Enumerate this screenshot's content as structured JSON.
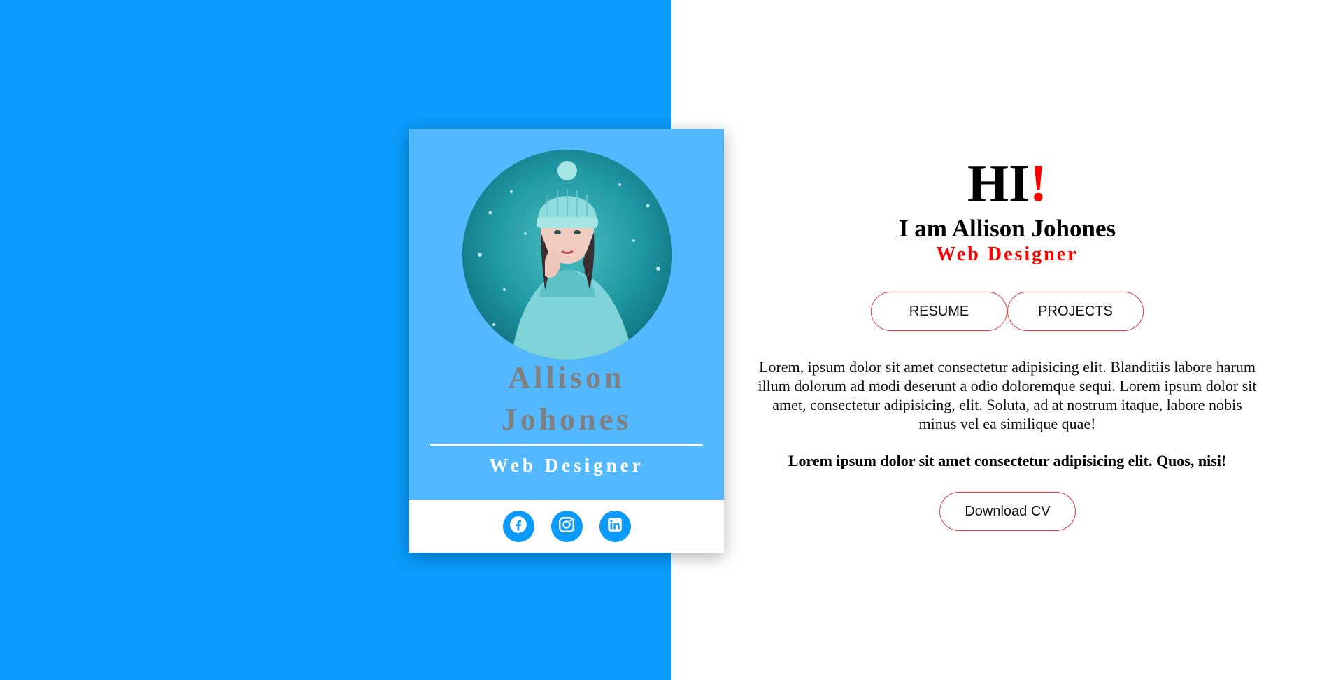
{
  "colors": {
    "left_background": "#0a9bfc",
    "card_top": "#53b8fd",
    "accent_red": "#ff0000",
    "button_border": "#e8383d",
    "name_gray": "#808080"
  },
  "card": {
    "name_line1": "Allison",
    "name_line2": "Johones",
    "role": "Web Designer",
    "social": [
      {
        "icon": "facebook-icon",
        "label": "Facebook"
      },
      {
        "icon": "instagram-icon",
        "label": "Instagram"
      },
      {
        "icon": "linkedin-icon",
        "label": "LinkedIn"
      }
    ]
  },
  "hero": {
    "greeting": "HI",
    "greeting_mark": "!",
    "intro": "I am Allison Johones",
    "role": "Web Designer"
  },
  "buttons": {
    "resume": "RESUME",
    "projects": "PROJECTS",
    "download": "Download CV"
  },
  "content": {
    "description": "Lorem, ipsum dolor sit amet consectetur adipisicing elit. Blanditiis labore harum illum dolorum ad modi deserunt a odio doloremque sequi. Lorem ipsum dolor sit amet, consectetur adipisicing, elit. Soluta, ad at nostrum itaque, labore nobis minus vel ea similique quae!",
    "highlight": "Lorem ipsum dolor sit amet consectetur adipisicing elit. Quos, nisi!"
  }
}
